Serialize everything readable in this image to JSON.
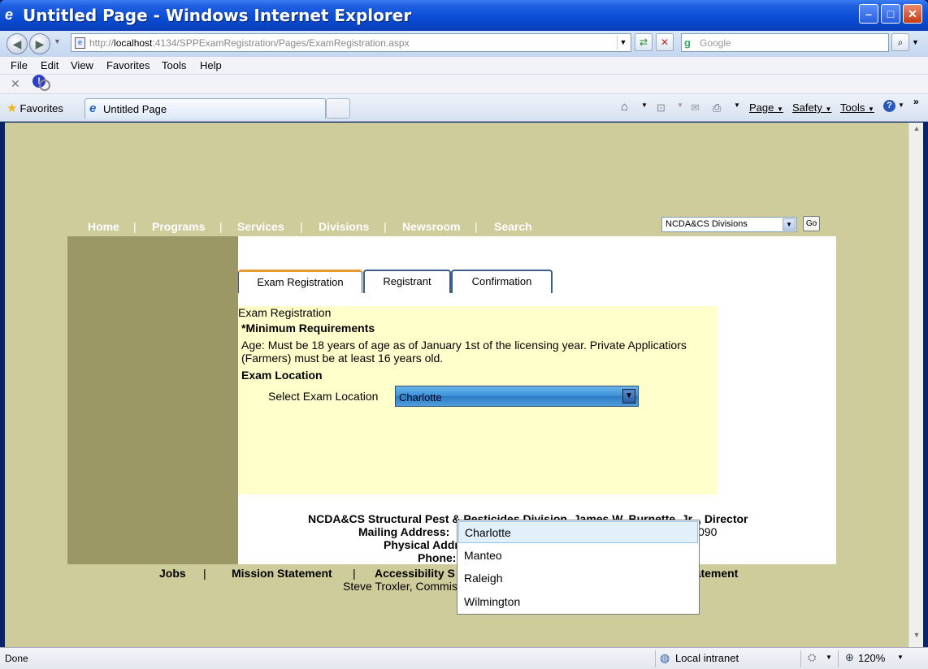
{
  "window": {
    "title": "Untitled Page - Windows Internet Explorer",
    "min": "–",
    "max": "□",
    "close": "✕"
  },
  "address": {
    "url_prefix": "http://",
    "url_host": "localhost",
    "url_rest": ":4134/SPPExamRegistration/Pages/ExamRegistration.aspx",
    "search_placeholder": "Google"
  },
  "menu": [
    "File",
    "Edit",
    "View",
    "Favorites",
    "Tools",
    "Help"
  ],
  "favorites_label": "Favorites",
  "browser_tab": "Untitled Page",
  "command_bar": {
    "page": "Page",
    "safety": "Safety",
    "tools": "Tools"
  },
  "site_nav": {
    "items": [
      "Home",
      "Programs",
      "Services",
      "Divisions",
      "Newsroom",
      "Search"
    ],
    "divisions_select": "NCDA&CS Divisions",
    "go": "Go"
  },
  "page_tabs": [
    "Exam Registration",
    "Registrant",
    "Confirmation"
  ],
  "exam": {
    "heading": "Exam Registration",
    "req_title": "*Minimum Requirements",
    "req_text": "Age: Must be 18 years of age as of January 1st of the licensing year. Private Applicatiors (Farmers) must be at least 16 years old.",
    "location_title": "Exam Location",
    "location_label": "Select Exam Location",
    "location_value": "Charlotte",
    "location_options": [
      "Charlotte",
      "Manteo",
      "Raleigh",
      "Wilmington"
    ]
  },
  "footer": {
    "line1": "NCDA&CS Structural Pest & Pesticides Division, James W. Burnette, Jr. , Director",
    "mailing": "Mailing Address:",
    "mailing_tail": "090",
    "physical": "Physical Addr",
    "phone": "Phone:",
    "links": [
      "Jobs",
      "Mission Statement",
      "Accessibility S",
      "tatement"
    ],
    "sep": "|",
    "commissioner": "Steve Troxler, Commis"
  },
  "status": {
    "text": "Done",
    "zone": "Local intranet",
    "zoom": "120%"
  }
}
